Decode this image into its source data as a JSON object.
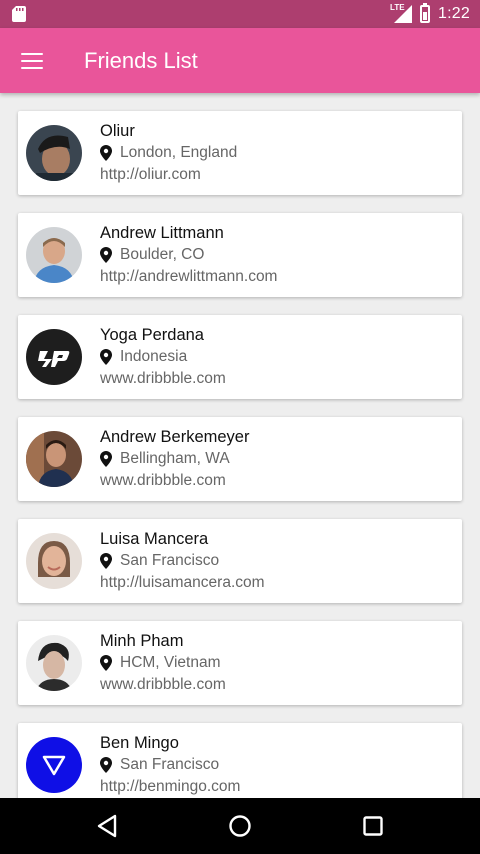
{
  "status_bar": {
    "network_label": "LTE",
    "time": "1:22",
    "icons": [
      "sd-card-icon",
      "lte-signal-icon",
      "battery-icon"
    ]
  },
  "app_bar": {
    "menu_icon": "hamburger-menu-icon",
    "title": "Friends List",
    "color": "#e9559a"
  },
  "friends": [
    {
      "name": "Oliur",
      "location": "London, England",
      "url": "http://oliur.com",
      "avatar_colors": [
        "#2a3540",
        "#a87d63"
      ]
    },
    {
      "name": "Andrew Littmann",
      "location": "Boulder, CO",
      "url": "http://andrewlittmann.com",
      "avatar_colors": [
        "#c9ccd0",
        "#4a86c8"
      ]
    },
    {
      "name": "Yoga Perdana",
      "location": "Indonesia",
      "url": "www.dribbble.com",
      "avatar_colors": [
        "#1e1e1e",
        "#ffffff"
      ]
    },
    {
      "name": "Andrew Berkemeyer",
      "location": "Bellingham, WA",
      "url": "www.dribbble.com",
      "avatar_colors": [
        "#5a3e32",
        "#203050"
      ]
    },
    {
      "name": "Luisa Mancera",
      "location": "San Francisco",
      "url": "http://luisamancera.com",
      "avatar_colors": [
        "#e6ded8",
        "#c6967c"
      ]
    },
    {
      "name": "Minh Pham",
      "location": "HCM, Vietnam",
      "url": "www.dribbble.com",
      "avatar_colors": [
        "#e8e8e8",
        "#2c2c2c"
      ]
    },
    {
      "name": "Ben Mingo",
      "location": "San Francisco",
      "url": "http://benmingo.com",
      "avatar_colors": [
        "#0f0fe6",
        "#ffffff"
      ]
    }
  ],
  "nav_bar": {
    "icons": [
      "back-triangle-icon",
      "home-circle-icon",
      "recents-square-icon"
    ]
  }
}
